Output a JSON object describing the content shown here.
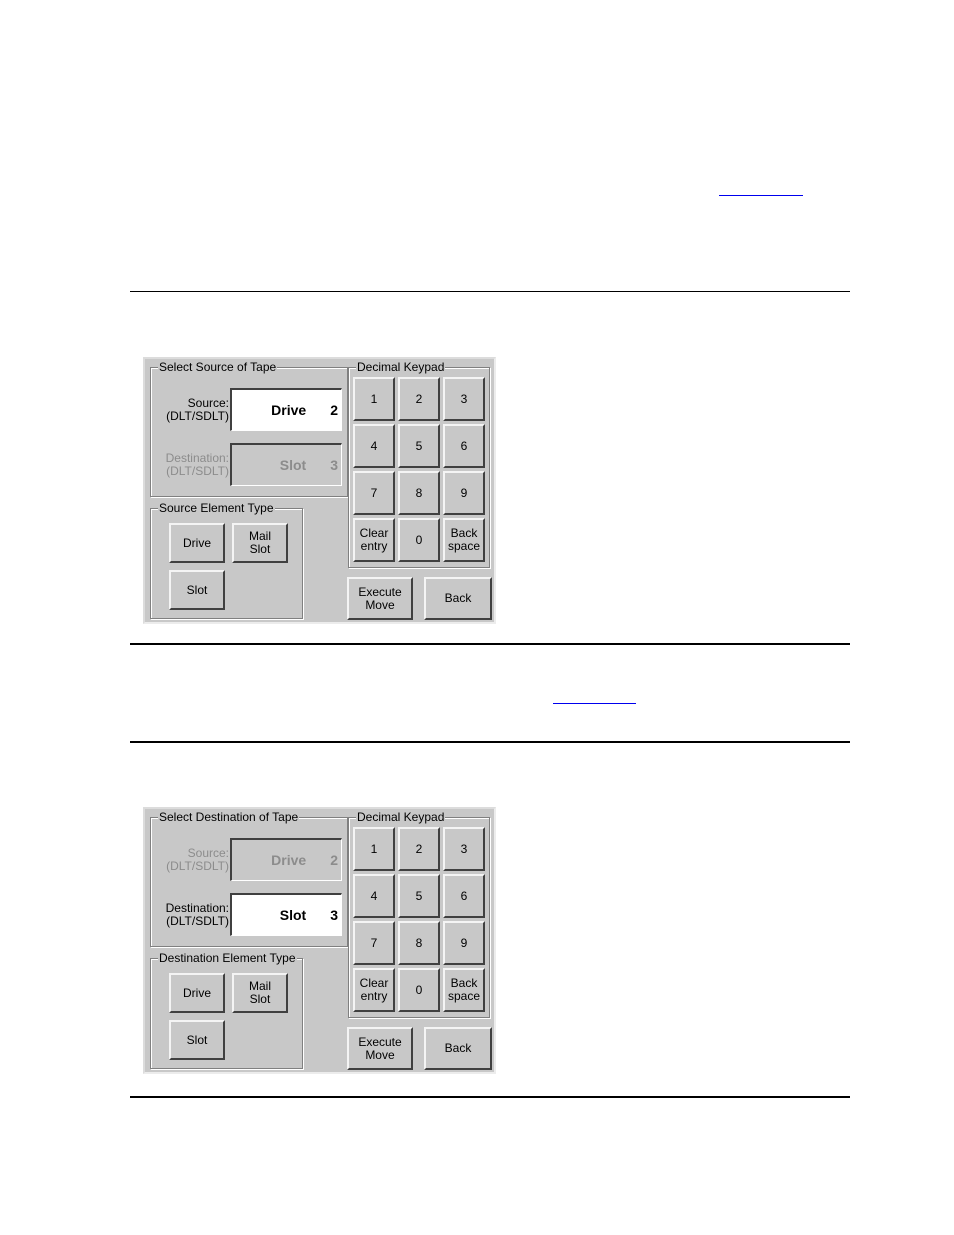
{
  "document": {
    "links": [
      {
        "text": ""
      },
      {
        "text": ""
      }
    ]
  },
  "panels": [
    {
      "id": "source",
      "select_group_title": "Select Source of Tape",
      "source_label_line1": "Source:",
      "source_label_line2": "(DLT/SDLT)",
      "source_value_name": "Drive",
      "source_value_number": "2",
      "source_state": "active",
      "destination_label_line1": "Destination:",
      "destination_label_line2": "(DLT/SDLT)",
      "destination_value_name": "Slot",
      "destination_value_number": "3",
      "destination_state": "disabled",
      "element_group_title": "Source Element Type",
      "element_buttons": {
        "drive": "Drive",
        "mail_slot": "Mail\nSlot",
        "slot": "Slot"
      },
      "keypad_title": "Decimal Keypad",
      "keys": [
        "1",
        "2",
        "3",
        "4",
        "5",
        "6",
        "7",
        "8",
        "9",
        "Clear\nentry",
        "0",
        "Back\nspace"
      ],
      "execute_move": "Execute\nMove",
      "back": "Back"
    },
    {
      "id": "destination",
      "select_group_title": "Select Destination of Tape",
      "source_label_line1": "Source:",
      "source_label_line2": "(DLT/SDLT)",
      "source_value_name": "Drive",
      "source_value_number": "2",
      "source_state": "disabled",
      "destination_label_line1": "Destination:",
      "destination_label_line2": "(DLT/SDLT)",
      "destination_value_name": "Slot",
      "destination_value_number": "3",
      "destination_state": "active",
      "element_group_title": "Destination Element Type",
      "element_buttons": {
        "drive": "Drive",
        "mail_slot": "Mail\nSlot",
        "slot": "Slot"
      },
      "keypad_title": "Decimal Keypad",
      "keys": [
        "1",
        "2",
        "3",
        "4",
        "5",
        "6",
        "7",
        "8",
        "9",
        "Clear\nentry",
        "0",
        "Back\nspace"
      ],
      "execute_move": "Execute\nMove",
      "back": "Back"
    }
  ]
}
